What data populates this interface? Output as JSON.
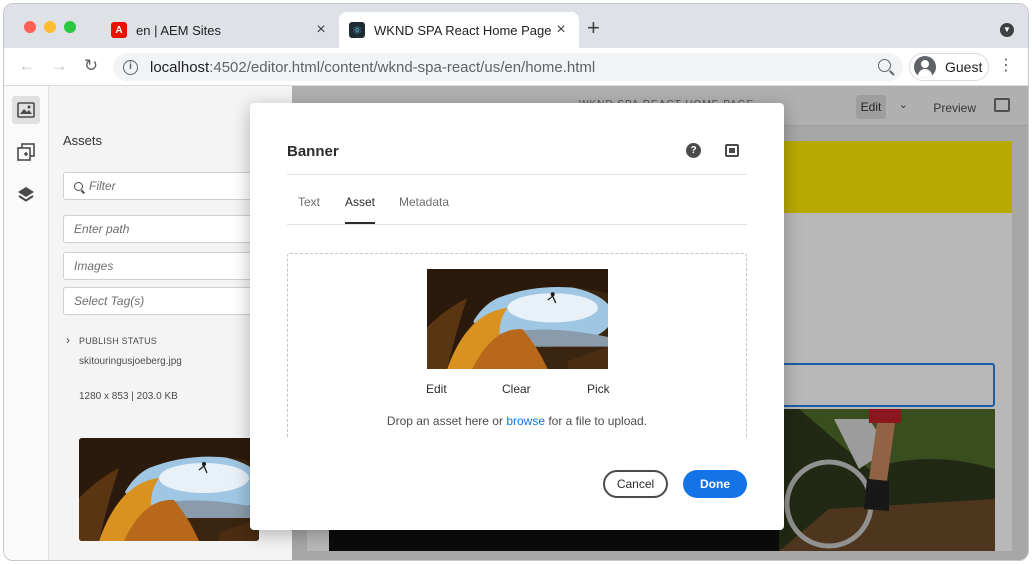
{
  "browser": {
    "tabs": [
      {
        "title": "en | AEM Sites",
        "favicon": "adobe-icon",
        "active": false
      },
      {
        "title": "WKND SPA React Home Page",
        "favicon": "react-icon",
        "active": true
      }
    ],
    "close_glyph": "×",
    "new_tab_glyph": "+",
    "url_host": "localhost",
    "url_path": ":4502/editor.html/content/wknd-spa-react/us/en/home.html",
    "profile_name": "Guest",
    "info_glyph": "i",
    "menu_glyph": "⋮",
    "back_glyph": "←",
    "forward_glyph": "→",
    "reload_glyph": "↻"
  },
  "rail": {
    "icons": [
      "assets-icon",
      "components-icon",
      "layers-icon"
    ]
  },
  "assets_panel": {
    "title": "Assets",
    "filter_placeholder": "Filter",
    "path_placeholder": "Enter path",
    "type_value": "Images",
    "tags_placeholder": "Select Tag(s)",
    "publish_status_label": "PUBLISH STATUS",
    "asset_name": "skitouringusjoeberg.jpg",
    "asset_dims": "1280 x 853 | 203.0 KB"
  },
  "editor": {
    "edit_label": "Edit",
    "preview_label": "Preview",
    "page_title": "WKND SPA REACT HOME PAGE"
  },
  "dialog": {
    "title": "Banner",
    "tabs": [
      "Text",
      "Asset",
      "Metadata"
    ],
    "active_tab": "Asset",
    "actions": {
      "edit": "Edit",
      "clear": "Clear",
      "pick": "Pick"
    },
    "drop_prefix": "Drop an asset here or ",
    "drop_link": "browse",
    "drop_suffix": " for a file to upload.",
    "help_glyph": "?",
    "cancel_label": "Cancel",
    "done_label": "Done"
  },
  "colors": {
    "accent": "#1473e6",
    "banner_yellow": "#ffea00",
    "selection_blue": "#2680eb"
  }
}
